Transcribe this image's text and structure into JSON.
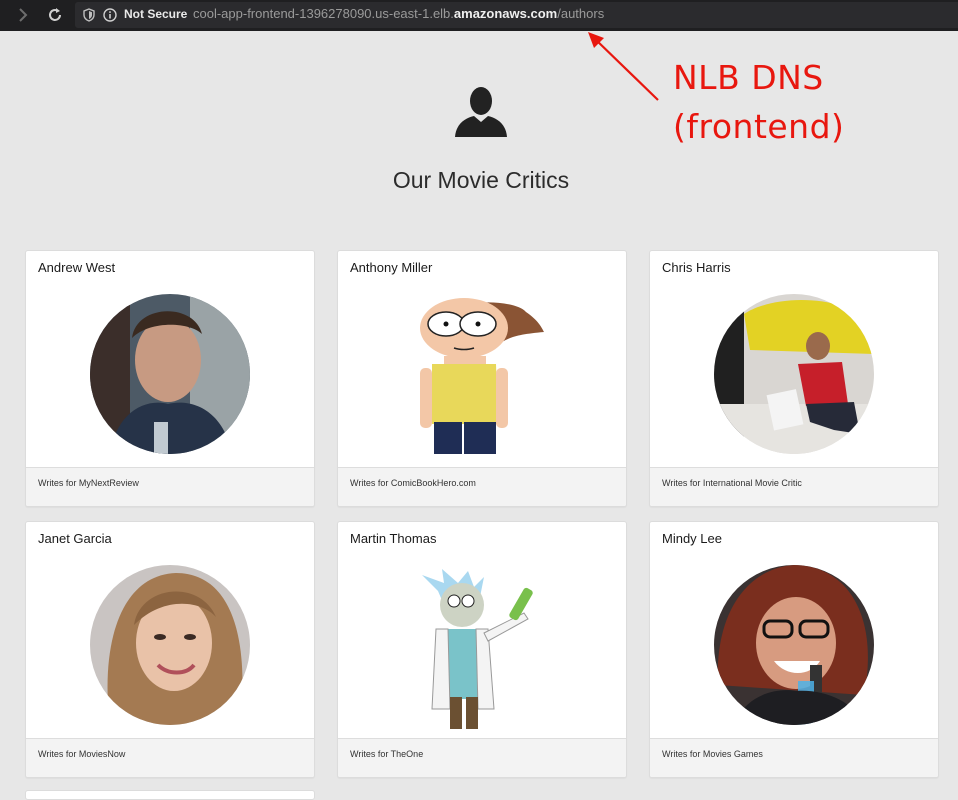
{
  "browser": {
    "security_label": "Not Secure",
    "url_prefix": "cool-app-frontend-1396278090.us-east-1.elb.",
    "url_domain": "amazonaws.com",
    "url_path": "/authors",
    "icons": [
      "forward-icon",
      "reload-icon",
      "shield-icon",
      "info-icon"
    ]
  },
  "annotation": {
    "line1": "NLB DNS",
    "line2": "(frontend)",
    "color": "#e8170f"
  },
  "page": {
    "title": "Our Movie Critics",
    "icon": "user-icon"
  },
  "critics": [
    {
      "name": "Andrew West",
      "writes_for": "Writes for MyNextReview",
      "photo": "photo-portrait"
    },
    {
      "name": "Anthony Miller",
      "writes_for": "Writes for ComicBookHero.com",
      "photo": "cartoon-morty"
    },
    {
      "name": "Chris Harris",
      "writes_for": "Writes for International Movie Critic",
      "photo": "photo-car"
    },
    {
      "name": "Janet Garcia",
      "writes_for": "Writes for MoviesNow",
      "photo": "photo-portrait"
    },
    {
      "name": "Martin Thomas",
      "writes_for": "Writes for TheOne",
      "photo": "cartoon-rick"
    },
    {
      "name": "Mindy Lee",
      "writes_for": "Writes for Movies Games",
      "photo": "photo-portrait"
    }
  ]
}
